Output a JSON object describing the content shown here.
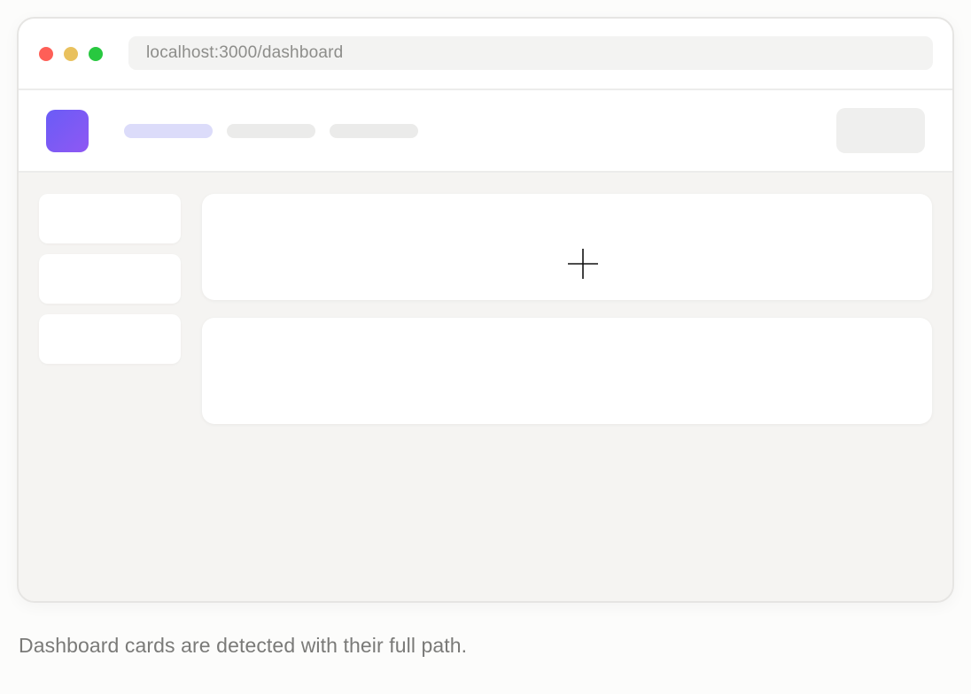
{
  "browser": {
    "url": "localhost:3000/dashboard",
    "traffic_lights": [
      "close",
      "minimize",
      "zoom"
    ]
  },
  "colors": {
    "close": "#fe5f57",
    "minimize": "#e9c15e",
    "zoom": "#28c840",
    "brand_gradient_start": "#6a5cf6",
    "brand_gradient_end": "#8f58f3",
    "active_nav": "#dcdcfa",
    "background": "#f5f4f2"
  },
  "app": {
    "nav_items": [
      "active-placeholder",
      "placeholder",
      "placeholder"
    ],
    "sidebar_cards": 3,
    "main_cards": 2
  },
  "cursor": {
    "icon": "crosshair-icon"
  },
  "caption": "Dashboard cards are detected with their full path."
}
